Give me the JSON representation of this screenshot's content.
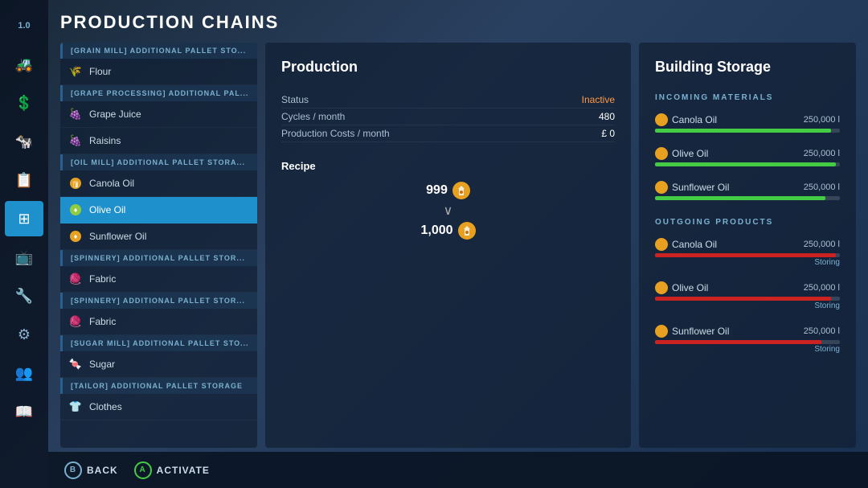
{
  "page": {
    "title": "PRODUCTION CHAINS",
    "version": "1.0"
  },
  "sidebar": {
    "items": [
      {
        "id": "version",
        "icon": "⊞",
        "label": "version",
        "active": false
      },
      {
        "id": "tractor",
        "icon": "🚜",
        "label": "tractor",
        "active": false
      },
      {
        "id": "money",
        "icon": "💰",
        "label": "money",
        "active": false
      },
      {
        "id": "animal",
        "icon": "🐄",
        "label": "animal",
        "active": false
      },
      {
        "id": "book",
        "icon": "📋",
        "label": "book",
        "active": false
      },
      {
        "id": "production",
        "icon": "⚙",
        "label": "production",
        "active": true
      },
      {
        "id": "monitor",
        "icon": "📊",
        "label": "monitor",
        "active": false
      },
      {
        "id": "machine",
        "icon": "🔧",
        "label": "machine",
        "active": false
      },
      {
        "id": "gear",
        "icon": "⚙",
        "label": "gear",
        "active": false
      },
      {
        "id": "org",
        "icon": "👥",
        "label": "org",
        "active": false
      },
      {
        "id": "guide",
        "icon": "📖",
        "label": "guide",
        "active": false
      }
    ]
  },
  "list": {
    "items": [
      {
        "type": "section",
        "label": "[GRAIN MILL] ADDITIONAL PALLET STO..."
      },
      {
        "type": "item",
        "icon": "flour",
        "label": "Flour",
        "active": false
      },
      {
        "type": "section",
        "label": "[GRAPE PROCESSING] ADDITIONAL PAL..."
      },
      {
        "type": "item",
        "icon": "juice",
        "label": "Grape Juice",
        "active": false
      },
      {
        "type": "item",
        "icon": "raisins",
        "label": "Raisins",
        "active": false
      },
      {
        "type": "section",
        "label": "[OIL MILL] ADDITIONAL PALLET STORA..."
      },
      {
        "type": "item",
        "icon": "oil",
        "label": "Canola Oil",
        "active": false
      },
      {
        "type": "item",
        "icon": "oil",
        "label": "Olive Oil",
        "active": true
      },
      {
        "type": "item",
        "icon": "oil",
        "label": "Sunflower Oil",
        "active": false
      },
      {
        "type": "section",
        "label": "[SPINNERY] ADDITIONAL PALLET STOR..."
      },
      {
        "type": "item",
        "icon": "fabric",
        "label": "Fabric",
        "active": false
      },
      {
        "type": "section",
        "label": "[SPINNERY] ADDITIONAL PALLET STOR..."
      },
      {
        "type": "item",
        "icon": "fabric",
        "label": "Fabric",
        "active": false
      },
      {
        "type": "section",
        "label": "[SUGAR MILL] ADDITIONAL PALLET STO..."
      },
      {
        "type": "item",
        "icon": "sugar",
        "label": "Sugar",
        "active": false
      },
      {
        "type": "section",
        "label": "[TAILOR] ADDITIONAL PALLET STORAGE"
      },
      {
        "type": "item",
        "icon": "clothes",
        "label": "Clothes",
        "active": false
      }
    ]
  },
  "production": {
    "title": "Production",
    "stats": [
      {
        "label": "Status",
        "value": "Inactive",
        "style": "inactive"
      },
      {
        "label": "Cycles / month",
        "value": "480",
        "style": "normal"
      },
      {
        "label": "Production Costs / month",
        "value": "£ 0",
        "style": "normal"
      }
    ],
    "recipe_label": "Recipe",
    "recipe_input": {
      "amount": "999",
      "icon": "oil"
    },
    "recipe_output": {
      "amount": "1,000",
      "icon": "oil"
    }
  },
  "storage": {
    "title": "Building Storage",
    "incoming_label": "INCOMING MATERIALS",
    "incoming": [
      {
        "name": "Canola Oil",
        "amount": "250,000 l",
        "fill": 95,
        "type": "green"
      },
      {
        "name": "Olive Oil",
        "amount": "250,000 l",
        "fill": 98,
        "type": "green"
      },
      {
        "name": "Sunflower Oil",
        "amount": "250,000 l",
        "fill": 92,
        "type": "green"
      }
    ],
    "outgoing_label": "OUTGOING PRODUCTS",
    "outgoing": [
      {
        "name": "Canola Oil",
        "amount": "250,000 l",
        "fill": 98,
        "type": "red",
        "status": "Storing"
      },
      {
        "name": "Olive Oil",
        "amount": "250,000 l",
        "fill": 95,
        "type": "red",
        "status": "Storing"
      },
      {
        "name": "Sunflower Oil",
        "amount": "250,000 l",
        "fill": 90,
        "type": "red",
        "status": "Storing"
      }
    ]
  },
  "bottom": {
    "back_key": "B",
    "back_label": "BACK",
    "activate_key": "A",
    "activate_label": "ACTIVATE"
  }
}
